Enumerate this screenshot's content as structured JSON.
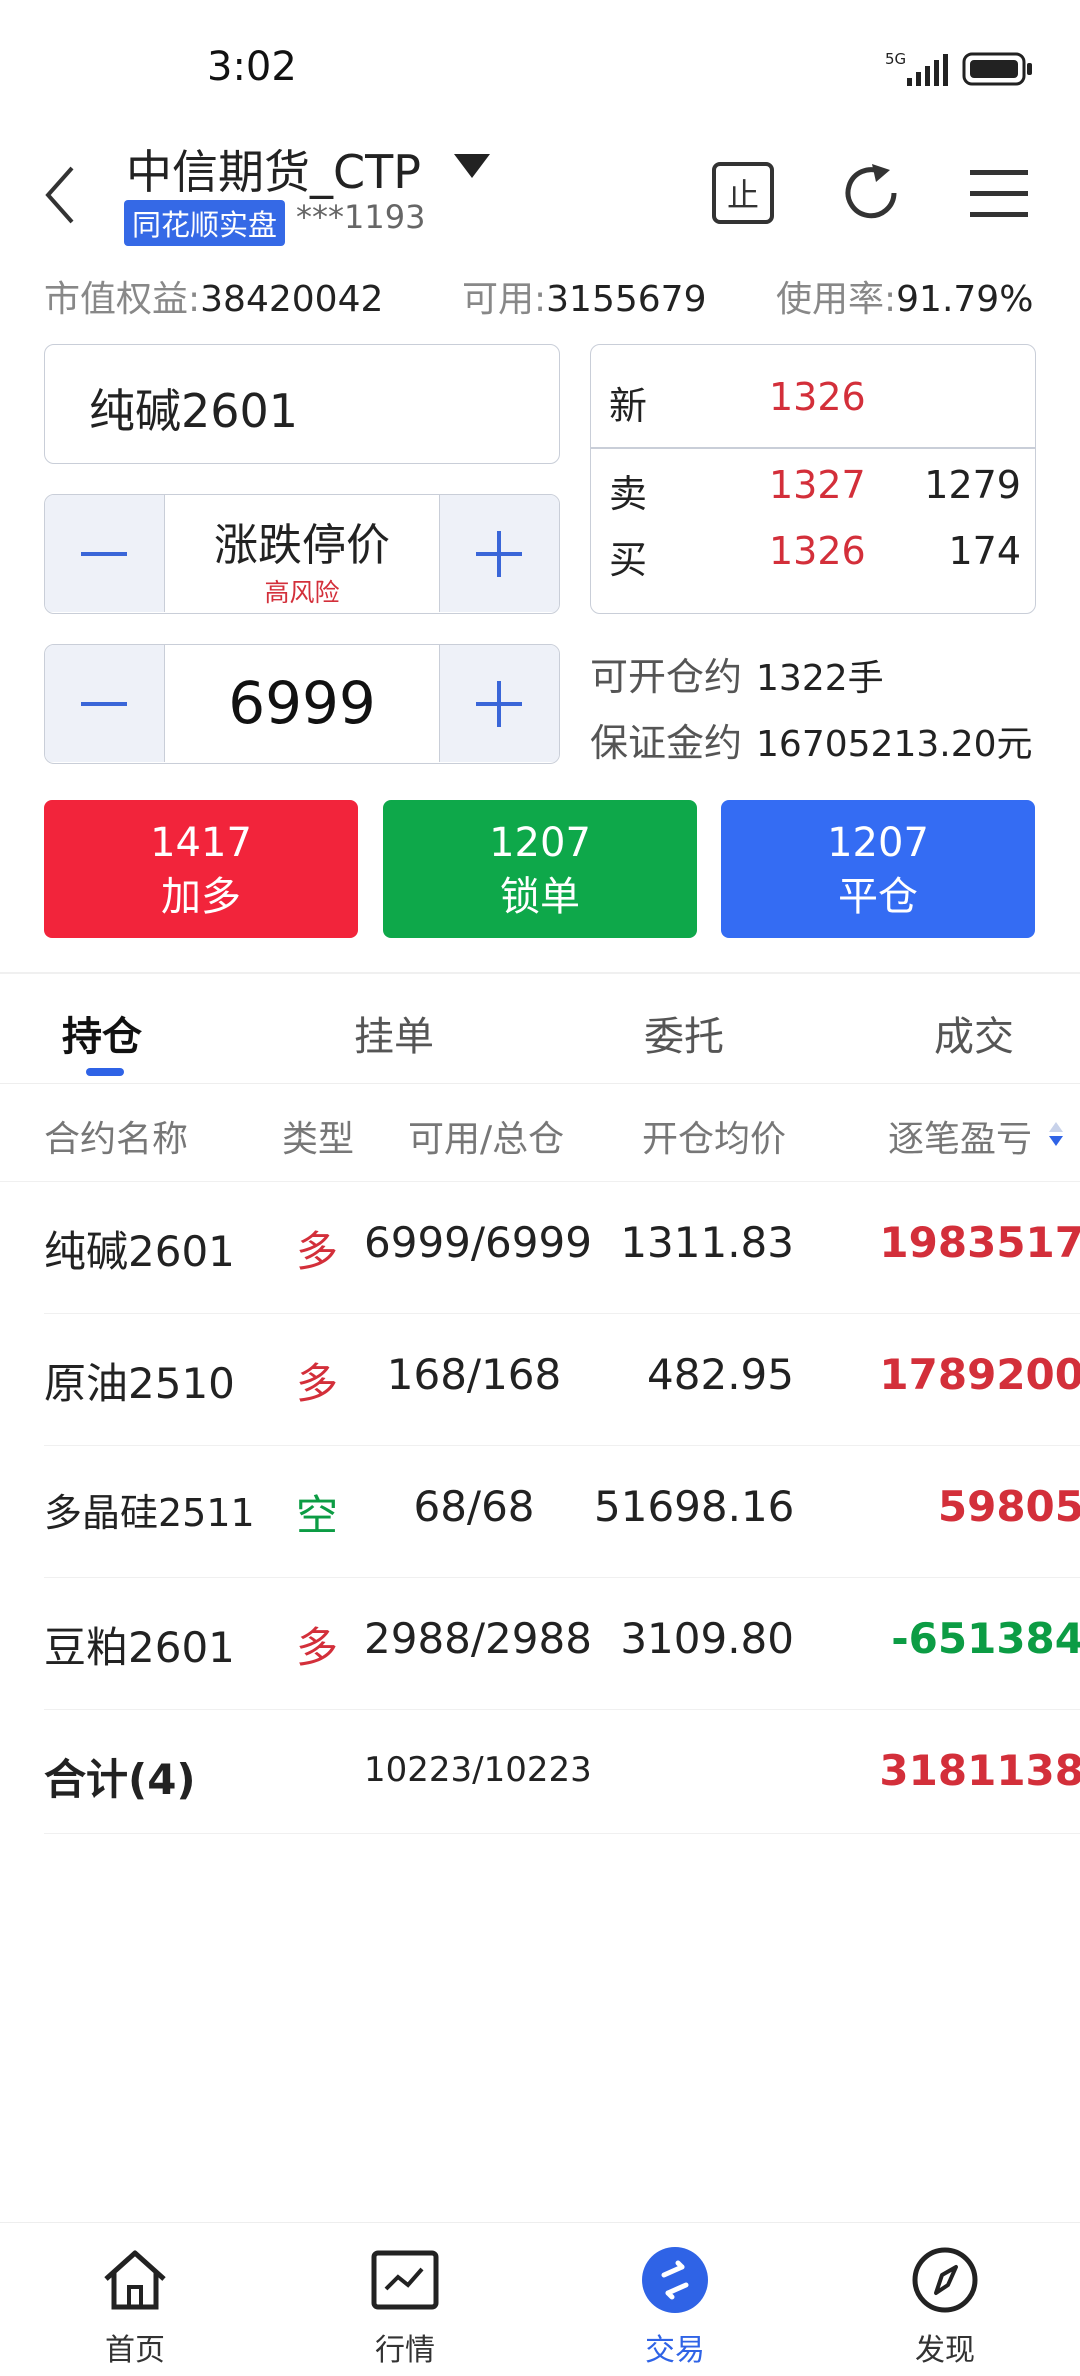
{
  "status_bar": {
    "time": "3:02",
    "network": "5G"
  },
  "header": {
    "account_name": "中信期货_CTP",
    "badge": "同花顺实盘",
    "account_number": "***1193",
    "icons": [
      "back-icon",
      "dropdown-caret-icon",
      "stop-icon",
      "refresh-icon",
      "menu-icon"
    ],
    "stop_glyph": "止"
  },
  "summary": {
    "equity_label": "市值权益:",
    "equity": "38420042",
    "available_label": "可用:",
    "available": "3155679",
    "usage_label": "使用率:",
    "usage": "91.79%"
  },
  "order": {
    "contract": "纯碱2601",
    "price_mode": "涨跌停价",
    "price_warning": "高风险",
    "quantity": "6999"
  },
  "quote": {
    "last_label": "新",
    "last": "1326",
    "ask_label": "卖",
    "ask": "1327",
    "ask_volume": "1279",
    "bid_label": "买",
    "bid": "1326",
    "bid_volume": "174"
  },
  "info": {
    "openable_label": "可开仓约",
    "openable": "1322手",
    "margin_label": "保证金约",
    "margin": "16705213.20元"
  },
  "buttons": [
    {
      "value": "1417",
      "label": "加多",
      "color": "#f2243b"
    },
    {
      "value": "1207",
      "label": "锁单",
      "color": "#0ea84a"
    },
    {
      "value": "1207",
      "label": "平仓",
      "color": "#346cf3"
    }
  ],
  "tabs": [
    "持仓",
    "挂单",
    "委托",
    "成交"
  ],
  "table": {
    "headers": [
      "合约名称",
      "类型",
      "可用/总仓",
      "开仓均价",
      "逐笔盈亏"
    ],
    "rows": [
      {
        "name": "纯碱2601",
        "type": "多",
        "avail": "6999/6999",
        "avg": "1311.83",
        "pl": "1983517"
      },
      {
        "name": "原油2510",
        "type": "多",
        "avail": "168/168",
        "avg": "482.95",
        "pl": "1789200"
      },
      {
        "name": "多晶硅2511",
        "type": "空",
        "avail": "68/68",
        "avg": "51698.16",
        "pl": "59805"
      },
      {
        "name": "豆粕2601",
        "type": "多",
        "avail": "2988/2988",
        "avg": "3109.80",
        "pl": "-651384"
      }
    ],
    "total": {
      "name": "合计(4)",
      "avail": "10223/10223",
      "pl": "3181138"
    }
  },
  "nav": [
    {
      "label": "首页",
      "icon": "home-icon"
    },
    {
      "label": "行情",
      "icon": "chart-icon"
    },
    {
      "label": "交易",
      "icon": "trade-icon"
    },
    {
      "label": "发现",
      "icon": "compass-icon"
    }
  ],
  "colors": {
    "accent": "#2f63e6",
    "up": "#d32f3a",
    "down": "#0c9c44"
  }
}
